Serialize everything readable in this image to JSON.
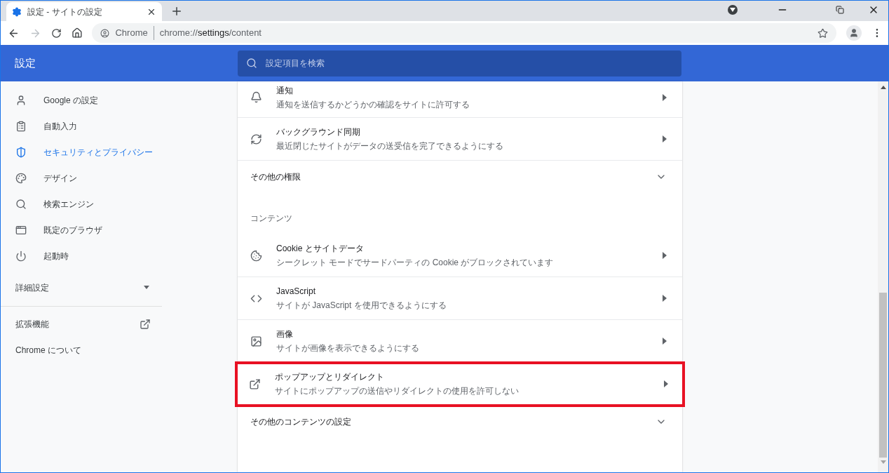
{
  "browser": {
    "tab_title": "設定 - サイトの設定",
    "address": {
      "origin": "Chrome",
      "scheme": "chrome://",
      "host": "settings",
      "path": "/content"
    }
  },
  "header": {
    "title": "設定",
    "search_placeholder": "設定項目を検索"
  },
  "sidebar": {
    "items": [
      {
        "label": "Google の設定",
        "selected": false
      },
      {
        "label": "自動入力",
        "selected": false
      },
      {
        "label": "セキュリティとプライバシー",
        "selected": true
      },
      {
        "label": "デザイン",
        "selected": false
      },
      {
        "label": "検索エンジン",
        "selected": false
      },
      {
        "label": "既定のブラウザ",
        "selected": false
      },
      {
        "label": "起動時",
        "selected": false
      }
    ],
    "advanced": {
      "label": "詳細設定",
      "expanded": false
    },
    "links": [
      {
        "label": "拡張機能",
        "external": true
      },
      {
        "label": "Chrome について",
        "external": false
      }
    ]
  },
  "content": [
    {
      "kind": "row",
      "title": "通知",
      "subtitle": "通知を送信するかどうかの確認をサイトに許可する",
      "highlighted": false
    },
    {
      "kind": "row",
      "title": "バックグラウンド同期",
      "subtitle": "最近閉じたサイトがデータの送受信を完了できるようにする",
      "highlighted": false
    },
    {
      "kind": "expander",
      "title": "その他の権限",
      "expanded": false
    },
    {
      "kind": "heading",
      "title": "コンテンツ"
    },
    {
      "kind": "row",
      "title": "Cookie とサイトデータ",
      "subtitle": "シークレット モードでサードパーティの Cookie がブロックされています",
      "highlighted": false
    },
    {
      "kind": "row",
      "title": "JavaScript",
      "subtitle": "サイトが JavaScript を使用できるようにする",
      "highlighted": false
    },
    {
      "kind": "row",
      "title": "画像",
      "subtitle": "サイトが画像を表示できるようにする",
      "highlighted": false
    },
    {
      "kind": "row",
      "title": "ポップアップとリダイレクト",
      "subtitle": "サイトにポップアップの送信やリダイレクトの使用を許可しない",
      "highlighted": true
    },
    {
      "kind": "expander",
      "title": "その他のコンテンツの設定",
      "expanded": false
    }
  ]
}
